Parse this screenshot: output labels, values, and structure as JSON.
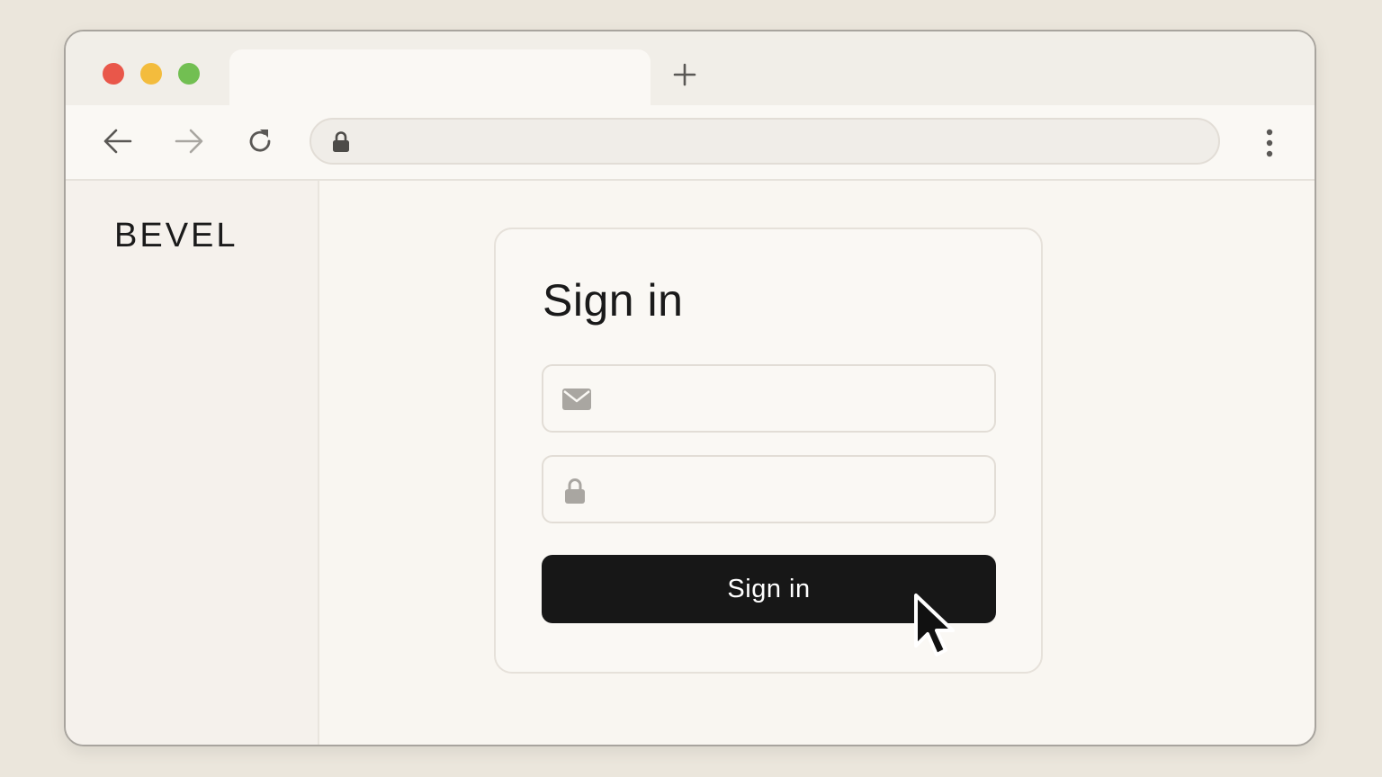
{
  "browser": {
    "window_controls": [
      "close",
      "minimize",
      "maximize"
    ],
    "active_tab": {
      "title": ""
    },
    "new_tab_icon": "plus-icon",
    "nav": {
      "back_icon": "arrow-left-icon",
      "forward_icon": "arrow-right-icon",
      "reload_icon": "reload-icon"
    },
    "address_bar": {
      "lock_icon": "lock-icon",
      "url": ""
    },
    "menu_icon": "kebab-menu-icon"
  },
  "sidebar": {
    "brand": "BEVEL"
  },
  "signin": {
    "title": "Sign in",
    "email": {
      "icon": "mail-icon",
      "value": "",
      "placeholder": ""
    },
    "password": {
      "icon": "lock-icon",
      "value": "",
      "placeholder": ""
    },
    "submit_label": "Sign in"
  },
  "colors": {
    "background": "#ebe6dc",
    "button": "#171717",
    "traffic_red": "#e9574a",
    "traffic_yellow": "#f3bc3d",
    "traffic_green": "#72bf52"
  }
}
